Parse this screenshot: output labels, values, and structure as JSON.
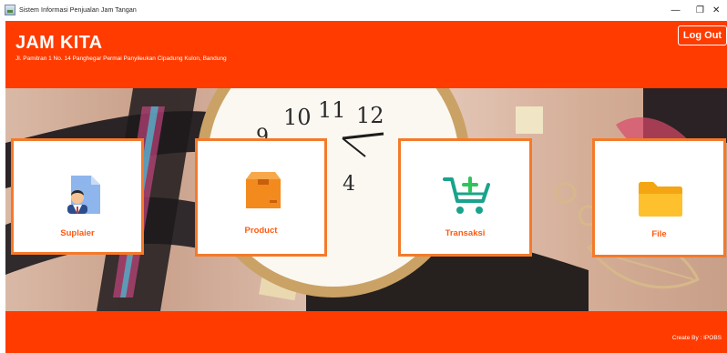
{
  "window": {
    "title": "Sistem Informasi Penjualan Jam Tangan",
    "minimize": "—",
    "restore": "❐",
    "close": "✕"
  },
  "header": {
    "brand": "JAM KITA",
    "address": "Jl. Pamitran 1 No. 14 Panghegar Permai Panyileukan Cipadung Kulon, Bandung",
    "logout_label": "Log Out"
  },
  "menu": {
    "suplaier": "Suplaier",
    "product": "Product",
    "transaksi": "Transaksi",
    "file": "File"
  },
  "footer": {
    "credit": "Create By : IPOBS"
  },
  "colors": {
    "primary": "#ff3b00",
    "card_border": "#f47a2a",
    "label": "#ff5a10"
  }
}
